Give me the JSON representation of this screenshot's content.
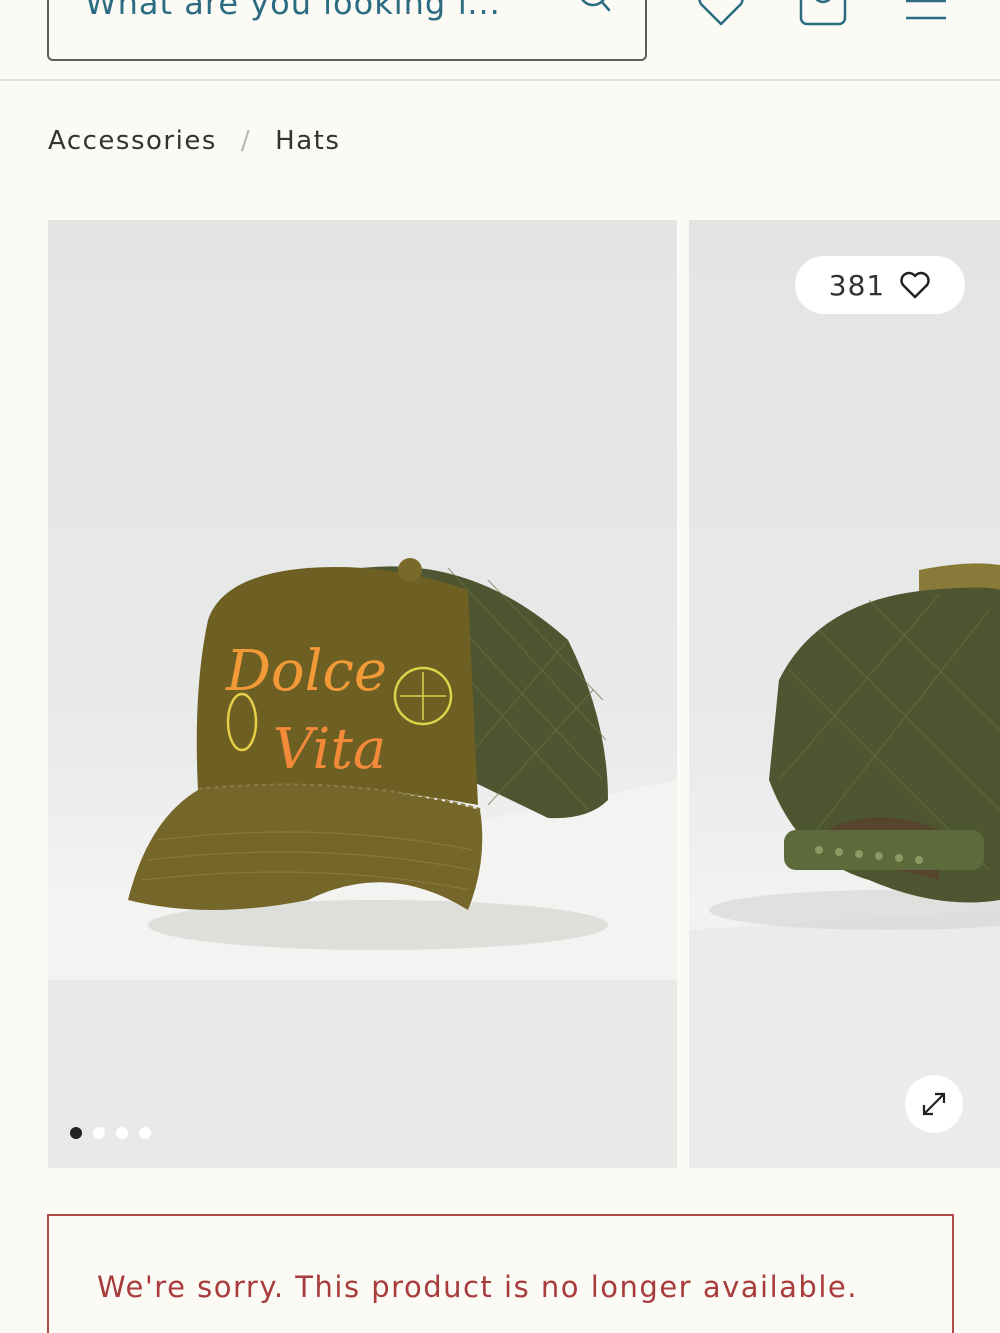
{
  "header": {
    "search": {
      "placeholder": "What are you looking f..."
    },
    "icons": [
      "search-icon",
      "heart-icon",
      "bag-icon",
      "menu-icon"
    ]
  },
  "breadcrumb": {
    "items": [
      "Accessories",
      "Hats"
    ],
    "separator": "/"
  },
  "gallery": {
    "likes_count": "381",
    "slide_count": 4,
    "active_slide": 1,
    "hat_print": {
      "line1": "Dolce",
      "line2": "Vita"
    }
  },
  "notice": {
    "message": "We're sorry. This product is no longer available."
  },
  "colors": {
    "search_text": "#2b6c82",
    "notice_border": "#b54a4a",
    "notice_text": "#a83c3c",
    "hat_olive": "#6e5f22",
    "mesh_green": "#4d5630"
  }
}
